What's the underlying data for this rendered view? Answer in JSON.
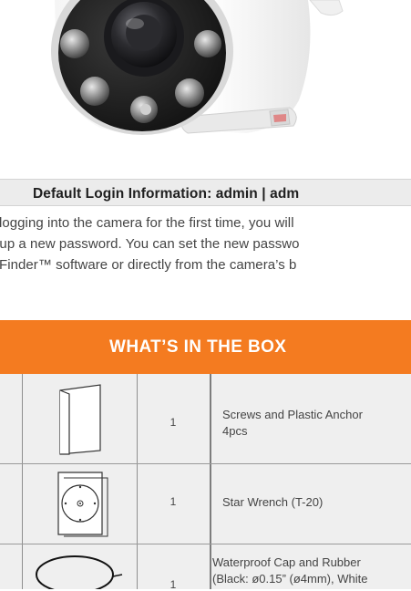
{
  "login": {
    "heading": "Default Login Information: admin | adm",
    "lines": [
      "logging into the camera for the first time, you will",
      "t up a new password. You can set the new passwo",
      "Finder™ software or directly from the camera’s b"
    ]
  },
  "box": {
    "title": "WHAT’S IN THE BOX",
    "items": [
      {
        "icon": "manual-booklet-icon",
        "qty": "1",
        "desc_lines": [
          "Screws and Plastic Anchor",
          "4pcs"
        ]
      },
      {
        "icon": "mounting-template-icon",
        "qty": "1",
        "desc_lines": [
          "Star Wrench (T-20)"
        ]
      },
      {
        "icon": "rubber-ring-icon",
        "qty": "1",
        "desc_lines": [
          "Waterproof Cap and Rubber ",
          "(Black: ø0.15” (ø4mm), White"
        ]
      }
    ]
  },
  "colors": {
    "accent": "#f47b20",
    "table_bg": "#efefef",
    "login_bar": "#ececec"
  }
}
